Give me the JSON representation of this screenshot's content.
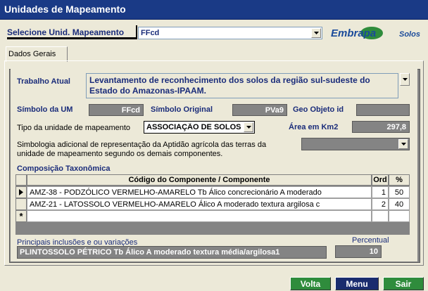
{
  "window": {
    "title": "Unidades de Mapeamento"
  },
  "selector": {
    "label": "Selecione Unid. Mapeamento",
    "value": "FFcd"
  },
  "logo": {
    "text_main": "Embrapa",
    "text_sub": "Solos"
  },
  "tabs": [
    {
      "label": "Dados Gerais"
    }
  ],
  "trabalho": {
    "label": "Trabalho Atual",
    "line1": "Levantamento de reconhecimento dos solos da região sul-sudeste do",
    "line2": "Estado do Amazonas-IPAAM."
  },
  "simbolo_um": {
    "label": "Símbolo da UM",
    "value": "FFcd"
  },
  "simbolo_original": {
    "label": "Símbolo Original",
    "value": "PVa9"
  },
  "geo_objeto": {
    "label": "Geo Objeto id",
    "value": ""
  },
  "tipo_unidade": {
    "label": "Tipo da unidade de mapeamento",
    "value": "ASSOCIAÇÃO DE SOLOS"
  },
  "area": {
    "label": "Área em Km2",
    "value": "297,8"
  },
  "simbologia": {
    "line1": "Simbologia adicional de representação da Aptidão agrícola das terras da",
    "line2": "unidade de mapeamento segundo os demais componentes.",
    "value": ""
  },
  "composicao": {
    "title": "Composição Taxonômica",
    "headers": {
      "componente": "Código do Componente / Componente",
      "ord": "Ord",
      "pct": "%"
    },
    "rows": [
      {
        "componente": "AMZ-38 - PODZÓLICO VERMELHO-AMARELO Tb Álico concrecionário A moderado",
        "ord": "1",
        "pct": "50"
      },
      {
        "componente": "AMZ-21 - LATOSSOLO VERMELHO-AMARELO Álico A moderado textura argilosa c",
        "ord": "2",
        "pct": "40"
      }
    ],
    "new_row_marker": "*"
  },
  "inclusoes": {
    "label": "Principais inclusões e ou variações",
    "value": "PLINTOSSOLO PÉTRICO Tb Álico A moderado textura média/argilosa1"
  },
  "percentual": {
    "label": "Percentual",
    "value": "10"
  },
  "buttons": {
    "volta": "Volta",
    "menu": "Menu",
    "sair": "Sair"
  },
  "colors": {
    "title_bar": "#1a3a86",
    "field_dark": "#848484",
    "btn_green": "#2f8c3c",
    "btn_navy": "#1a2c6e",
    "label_blue": "#1a2c7a"
  }
}
